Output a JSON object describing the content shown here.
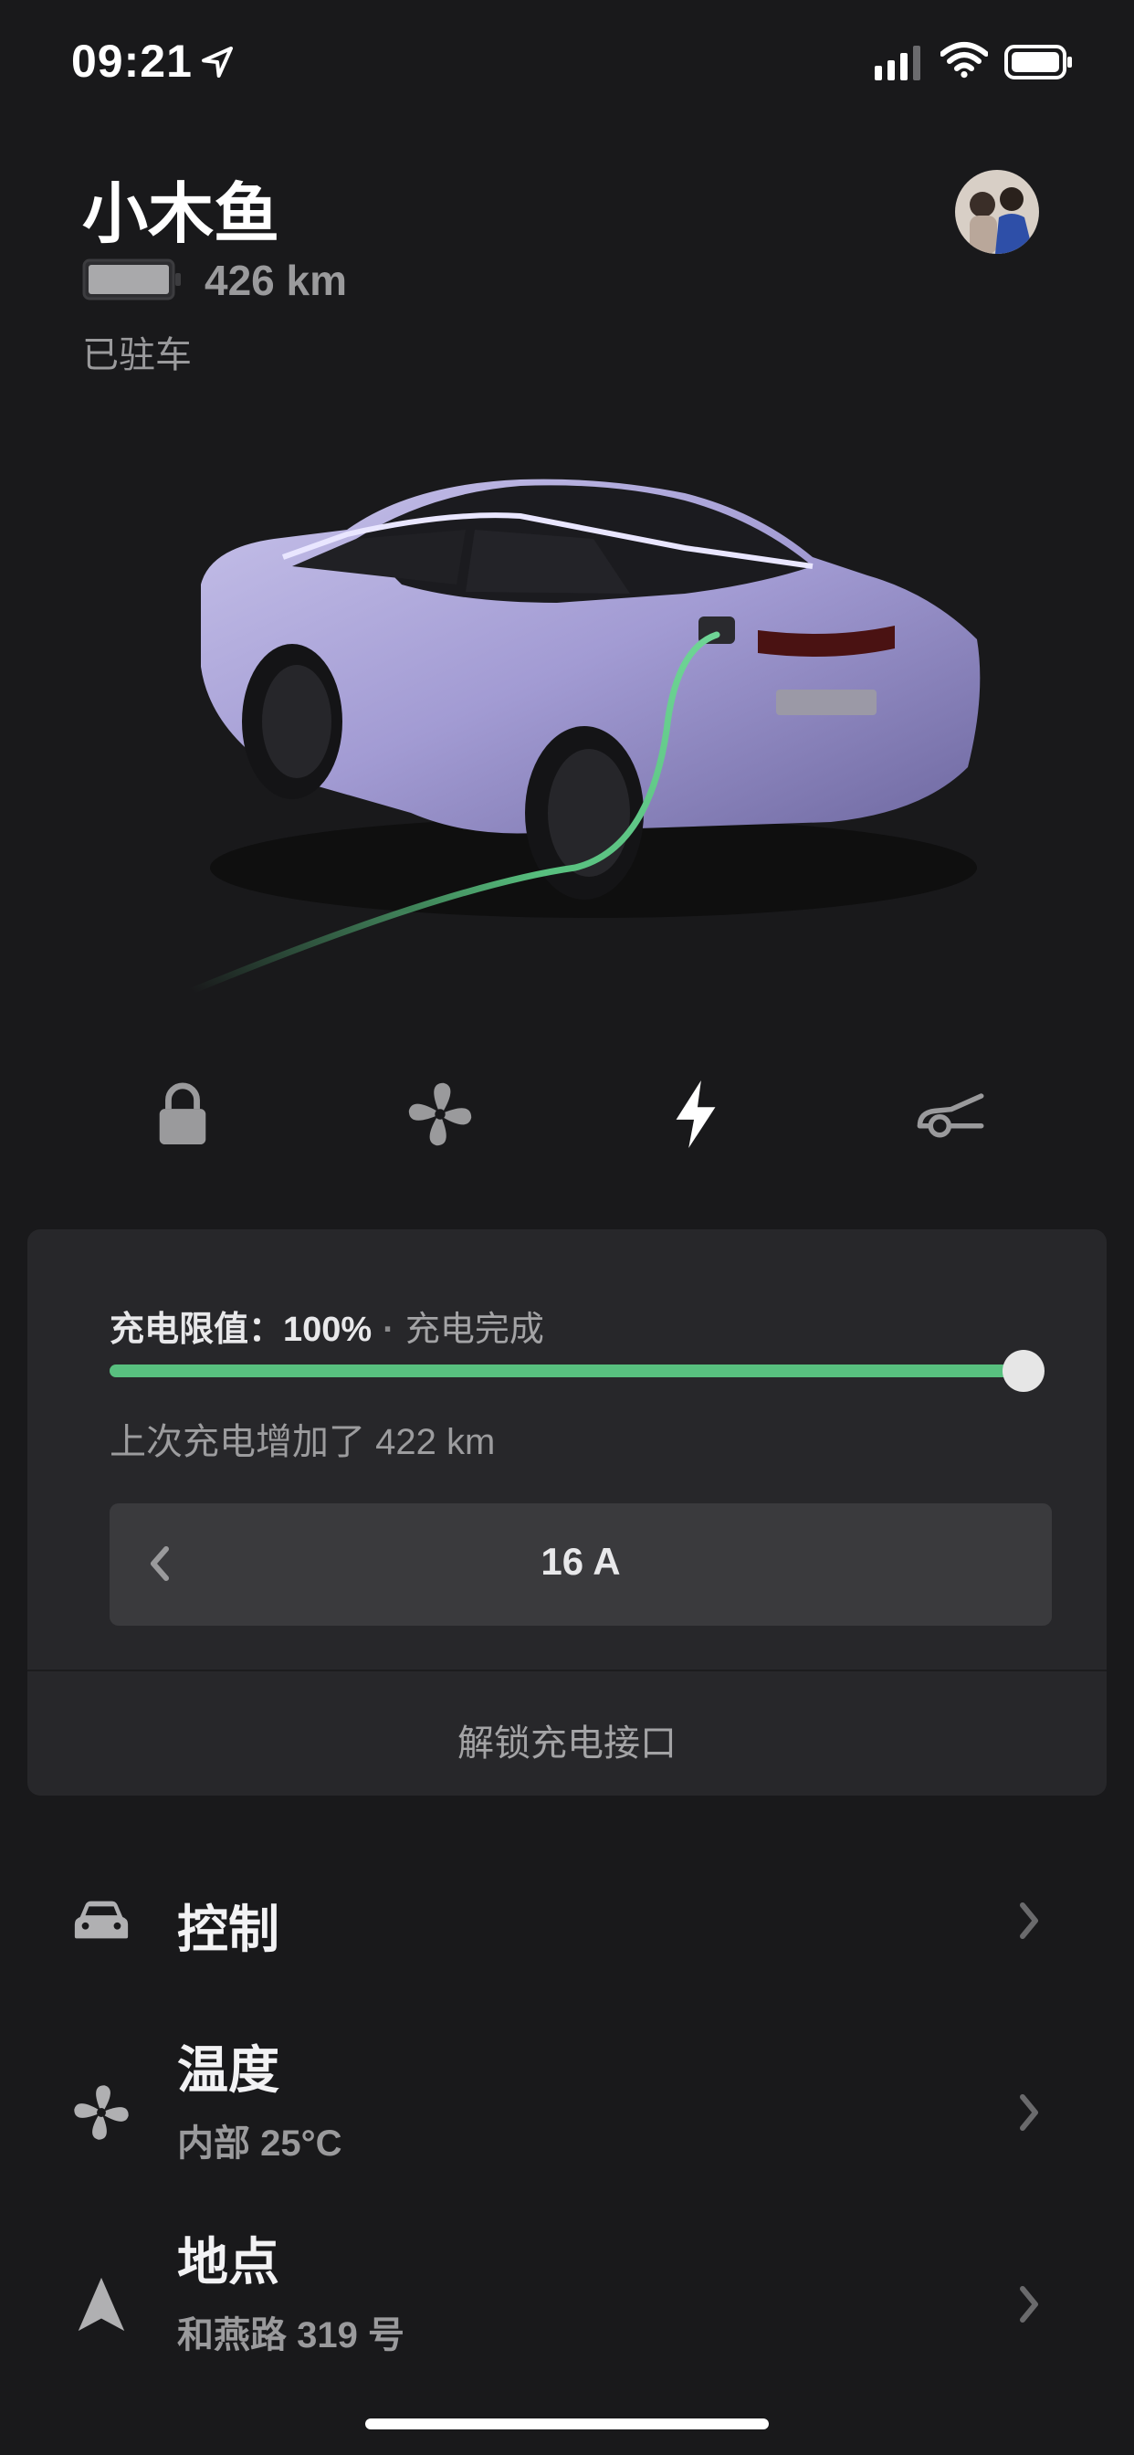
{
  "status_bar": {
    "time": "09:21"
  },
  "vehicle": {
    "name": "小木鱼",
    "range": "426 km",
    "status": "已驻车"
  },
  "quick_controls": [
    {
      "name": "lock",
      "icon": "lock-icon"
    },
    {
      "name": "climate",
      "icon": "fan-icon"
    },
    {
      "name": "charge",
      "icon": "lightning-icon"
    },
    {
      "name": "trunk",
      "icon": "car-trunk-icon"
    }
  ],
  "charging": {
    "limit_label": "充电限值：",
    "limit_value": "100%",
    "separator": "·",
    "state": "充电完成",
    "limit_fraction": 1.0,
    "last_session": "上次充电增加了 422 km",
    "current": "16 A",
    "unlock_port": "解锁充电接口"
  },
  "menu": {
    "controls": {
      "title": "控制",
      "icon": "car-icon"
    },
    "climate": {
      "title": "温度",
      "subtitle": "内部 25°C",
      "icon": "fan-icon"
    },
    "location": {
      "title": "地点",
      "subtitle": "和燕路 319 号",
      "icon": "navigation-arrow-icon"
    }
  },
  "colors": {
    "background": "#19191b",
    "card": "#27272a",
    "accent_green": "#58c07f",
    "car_paint": "#a8a1d6"
  }
}
